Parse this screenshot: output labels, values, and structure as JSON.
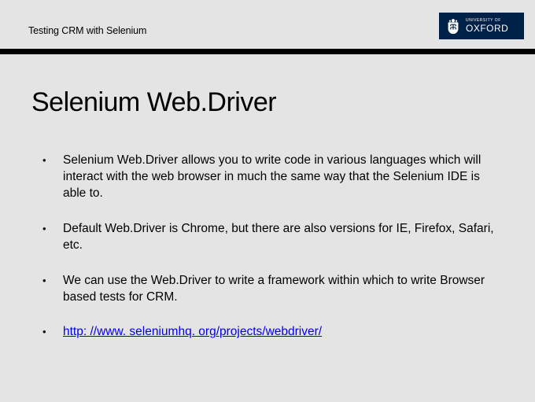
{
  "header": {
    "title": "Testing CRM with Selenium",
    "logo": {
      "small_line": "UNIVERSITY OF",
      "big_line": "OXFORD"
    }
  },
  "slide": {
    "title": "Selenium Web.Driver",
    "bullets": [
      {
        "text": "Selenium Web.Driver allows you to write code in various languages which will interact with the web browser in much the same way that the Selenium IDE is able to.",
        "is_link": false
      },
      {
        "text": "Default Web.Driver is Chrome, but there are also versions for IE, Firefox, Safari, etc.",
        "is_link": false
      },
      {
        "text": "We can use the Web.Driver to write a framework within which to write Browser based tests for CRM.",
        "is_link": false
      },
      {
        "text": "http: //www. seleniumhq. org/projects/webdriver/",
        "is_link": true
      }
    ]
  }
}
